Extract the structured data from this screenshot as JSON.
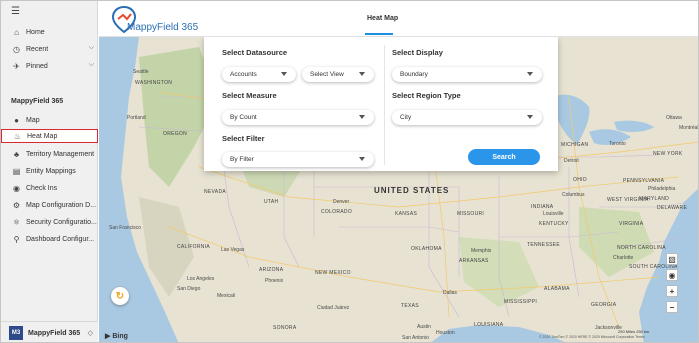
{
  "nav": {
    "top_items": [
      {
        "label": "Home",
        "icon": "home-icon"
      },
      {
        "label": "Recent",
        "icon": "clock-icon"
      },
      {
        "label": "Pinned",
        "icon": "pin-icon"
      }
    ],
    "section_title": "MappyField 365",
    "items": [
      {
        "label": "Map",
        "icon": "map-pin-icon"
      },
      {
        "label": "Heat Map",
        "icon": "heat-map-icon"
      },
      {
        "label": "Territory Management",
        "icon": "territory-icon"
      },
      {
        "label": "Entity Mappings",
        "icon": "document-icon"
      },
      {
        "label": "Check Ins",
        "icon": "check-in-icon"
      },
      {
        "label": "Map Configuration D...",
        "icon": "settings-icon"
      },
      {
        "label": "Security Configuratio...",
        "icon": "security-icon"
      },
      {
        "label": "Dashboard Configur...",
        "icon": "dashboard-icon"
      }
    ],
    "footer": {
      "badge": "M3",
      "label": "MappyField 365"
    }
  },
  "header": {
    "brand": "MappyField 365",
    "title": "Heat Map"
  },
  "panel": {
    "datasource_label": "Select Datasource",
    "datasource_value": "Accounts",
    "view_value": "Select View",
    "measure_label": "Select Measure",
    "measure_value": "By Count",
    "filter_label": "Select Filter",
    "filter_value": "By Filter",
    "display_label": "Select Display",
    "display_value": "Boundary",
    "region_label": "Select Region Type",
    "region_value": "City",
    "search_label": "Search"
  },
  "map": {
    "country_label": "UNITED STATES",
    "labels": [
      {
        "text": "Seattle",
        "cls": "city"
      },
      {
        "text": "WASHINGTON",
        "cls": "state"
      },
      {
        "text": "Portland",
        "cls": "city"
      },
      {
        "text": "OREGON",
        "cls": "state"
      },
      {
        "text": "NEVADA",
        "cls": "state"
      },
      {
        "text": "UTAH",
        "cls": "state"
      },
      {
        "text": "Denver",
        "cls": "city"
      },
      {
        "text": "COLORADO",
        "cls": "state"
      },
      {
        "text": "KANSAS",
        "cls": "state"
      },
      {
        "text": "MISSOURI",
        "cls": "state"
      },
      {
        "text": "San Francisco",
        "cls": "city"
      },
      {
        "text": "CALIFORNIA",
        "cls": "state"
      },
      {
        "text": "Las Vegas",
        "cls": "city"
      },
      {
        "text": "ARIZONA",
        "cls": "state"
      },
      {
        "text": "Phoenix",
        "cls": "city"
      },
      {
        "text": "Los Angeles",
        "cls": "city"
      },
      {
        "text": "San Diego",
        "cls": "city"
      },
      {
        "text": "Mexicali",
        "cls": "city"
      },
      {
        "text": "NEW MEXICO",
        "cls": "state"
      },
      {
        "text": "Ciudad Juárez",
        "cls": "city"
      },
      {
        "text": "SONORA",
        "cls": "state"
      },
      {
        "text": "OKLAHOMA",
        "cls": "state"
      },
      {
        "text": "Memphis",
        "cls": "city"
      },
      {
        "text": "ARKANSAS",
        "cls": "state"
      },
      {
        "text": "TENNESSEE",
        "cls": "state"
      },
      {
        "text": "Dallas",
        "cls": "city"
      },
      {
        "text": "TEXAS",
        "cls": "state"
      },
      {
        "text": "MISSISSIPPI",
        "cls": "state"
      },
      {
        "text": "ALABAMA",
        "cls": "state"
      },
      {
        "text": "GEORGIA",
        "cls": "state"
      },
      {
        "text": "LOUISIANA",
        "cls": "state"
      },
      {
        "text": "Austin",
        "cls": "city"
      },
      {
        "text": "Houston",
        "cls": "city"
      },
      {
        "text": "San Antonio",
        "cls": "city"
      },
      {
        "text": "Jacksonville",
        "cls": "city"
      },
      {
        "text": "INDIANA",
        "cls": "state"
      },
      {
        "text": "OHIO",
        "cls": "state"
      },
      {
        "text": "Columbus",
        "cls": "city"
      },
      {
        "text": "KENTUCKY",
        "cls": "state"
      },
      {
        "text": "Louisville",
        "cls": "city"
      },
      {
        "text": "WEST VIRGINIA",
        "cls": "state"
      },
      {
        "text": "VIRGINIA",
        "cls": "state"
      },
      {
        "text": "NORTH CAROLINA",
        "cls": "state"
      },
      {
        "text": "Charlotte",
        "cls": "city"
      },
      {
        "text": "SOUTH CAROLINA",
        "cls": "state"
      },
      {
        "text": "PENNSYLVANIA",
        "cls": "state"
      },
      {
        "text": "Philadelphia",
        "cls": "city"
      },
      {
        "text": "MARYLAND",
        "cls": "state"
      },
      {
        "text": "DELAWARE",
        "cls": "state"
      },
      {
        "text": "NEW YORK",
        "cls": "state"
      },
      {
        "text": "Toronto",
        "cls": "city"
      },
      {
        "text": "Detroit",
        "cls": "city"
      },
      {
        "text": "MICHIGAN",
        "cls": "state"
      },
      {
        "text": "Ottawa",
        "cls": "city"
      },
      {
        "text": "Montréal",
        "cls": "city"
      }
    ],
    "bing": "Bing",
    "scale": "250 Miles      250 km",
    "copyright": "© 2020 TomTom © 2020 HERE © 2020 Microsoft Corporation Terms"
  },
  "tools": {
    "zoom_in": "+",
    "zoom_out": "−"
  },
  "colors": {
    "accent": "#2b95e9",
    "active_border": "#d9282f",
    "brand": "#2a6fb4"
  }
}
